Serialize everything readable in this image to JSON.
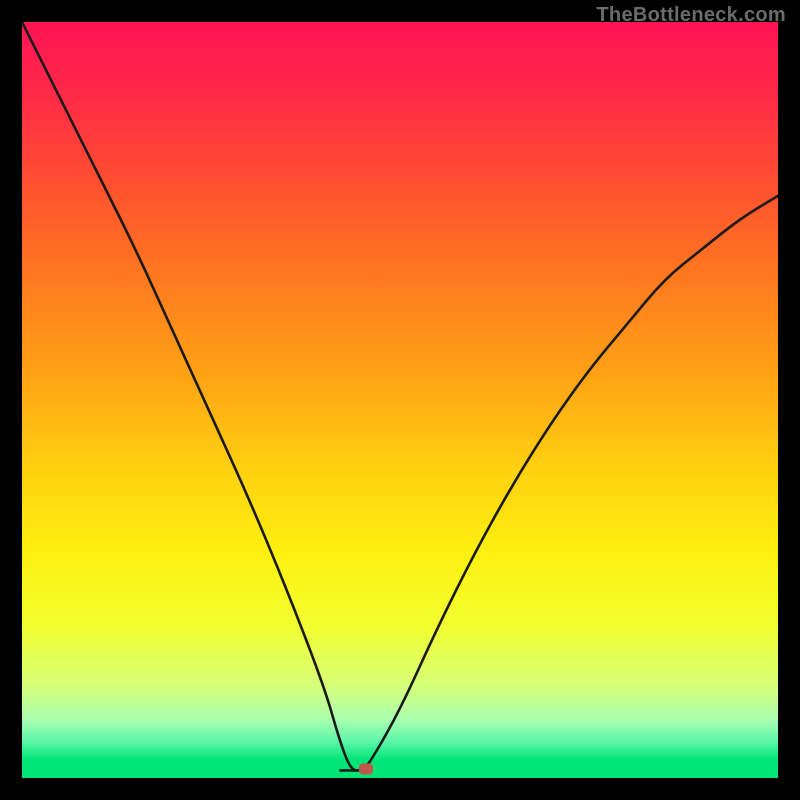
{
  "watermark": {
    "text": "TheBottleneck.com"
  },
  "layout": {
    "inner_left": 22,
    "inner_top": 22,
    "inner_width": 756,
    "inner_height": 756
  },
  "colors": {
    "outer_bg": "#000000",
    "gradient_stops": [
      {
        "offset": 0.0,
        "color": "#ff1454"
      },
      {
        "offset": 0.1,
        "color": "#ff2a47"
      },
      {
        "offset": 0.22,
        "color": "#ff5030"
      },
      {
        "offset": 0.35,
        "color": "#ff7a1e"
      },
      {
        "offset": 0.48,
        "color": "#ffa315"
      },
      {
        "offset": 0.6,
        "color": "#ffcf10"
      },
      {
        "offset": 0.72,
        "color": "#fff010"
      },
      {
        "offset": 0.82,
        "color": "#f2ff30"
      },
      {
        "offset": 0.9,
        "color": "#d6ff7a"
      },
      {
        "offset": 0.945,
        "color": "#aaffb0"
      },
      {
        "offset": 0.975,
        "color": "#5cf5a8"
      },
      {
        "offset": 1.0,
        "color": "#00e676"
      }
    ],
    "bottom_green": "#00e676",
    "curve_stroke": "#1a1a1a",
    "marker": "#c1584d",
    "watermark": "#6b6b6b"
  },
  "chart_data": {
    "type": "line",
    "title": "",
    "xlabel": "",
    "ylabel": "",
    "xlim": [
      0,
      100
    ],
    "ylim": [
      0,
      100
    ],
    "x": [
      0,
      5,
      10,
      15,
      20,
      25,
      30,
      35,
      40,
      42,
      43.5,
      45,
      46,
      50,
      55,
      60,
      65,
      70,
      75,
      80,
      85,
      90,
      95,
      100
    ],
    "values": [
      100,
      90,
      80,
      70,
      59,
      48,
      37,
      25,
      12,
      5,
      1,
      1,
      2,
      9,
      20,
      30,
      39,
      47,
      54,
      60,
      66,
      70,
      74,
      77
    ],
    "notch": {
      "x0": 42,
      "x1": 45.5,
      "y": 1
    },
    "marker": {
      "x": 45.5,
      "y": 1.2
    },
    "gradient_height_frac": 0.976,
    "green_band_frac": 0.024
  }
}
